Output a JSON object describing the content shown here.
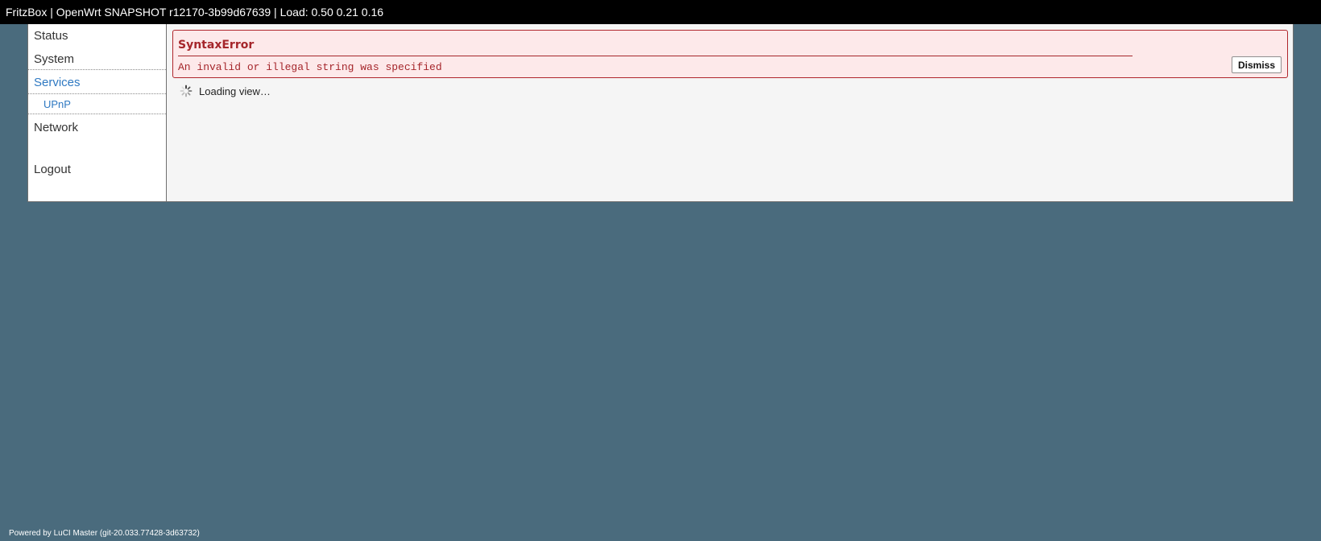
{
  "header": {
    "title": "FritzBox | OpenWrt SNAPSHOT r12170-3b99d67639 | Load: 0.50 0.21 0.16"
  },
  "sidebar": {
    "items": [
      {
        "label": "Status"
      },
      {
        "label": "System"
      },
      {
        "label": "Services",
        "active": true,
        "children": [
          {
            "label": "UPnP"
          }
        ]
      },
      {
        "label": "Network"
      },
      {
        "label": "Logout"
      }
    ]
  },
  "alert": {
    "title": "SyntaxError",
    "message": "An invalid or illegal string was specified",
    "dismiss_label": "Dismiss"
  },
  "loading": {
    "text": "Loading view…",
    "icon": "spinner-icon"
  },
  "footer": {
    "text": "Powered by LuCI Master (git-20.033.77428-3d63732)"
  },
  "colors": {
    "background": "#4a6b7d",
    "topbar": "#000000",
    "active_link": "#2f79c2",
    "error": "#a5262b",
    "error_bg": "#fde9ea"
  }
}
